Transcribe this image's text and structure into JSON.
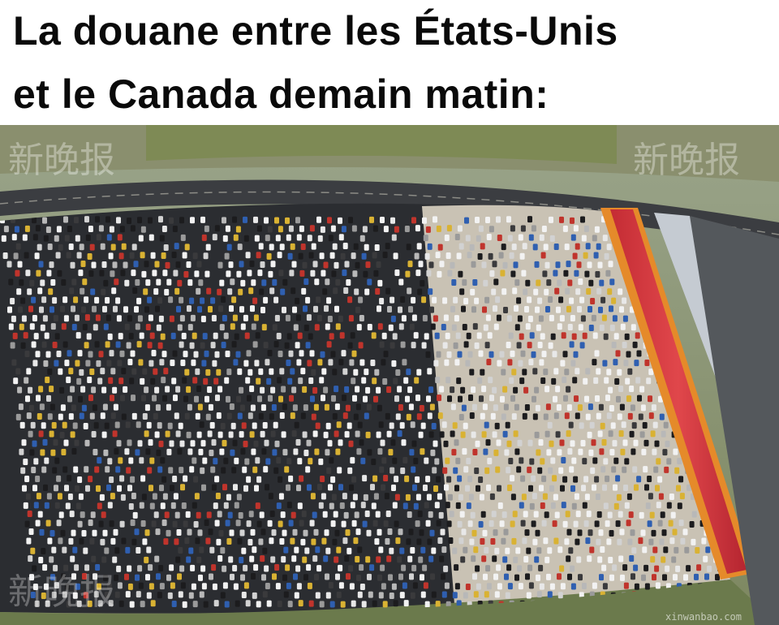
{
  "caption": {
    "line1": "La douane entre les États-Unis",
    "line2": "et le Canada demain matin:"
  },
  "photo": {
    "subject": "aerial-traffic-jam-toll-plaza",
    "watermarks": [
      "新晚报",
      "新晚报"
    ],
    "corner_watermark": "新晚报",
    "corner_url": "xinwanbao.com",
    "colors": {
      "asphalt": "#2b2d31",
      "plaza_concrete": "#c9c2b4",
      "toll_roof": "#d93a3f",
      "toll_trim": "#e58a2a",
      "grass": "#6b7a4c",
      "highway": "#3a3c40"
    }
  }
}
